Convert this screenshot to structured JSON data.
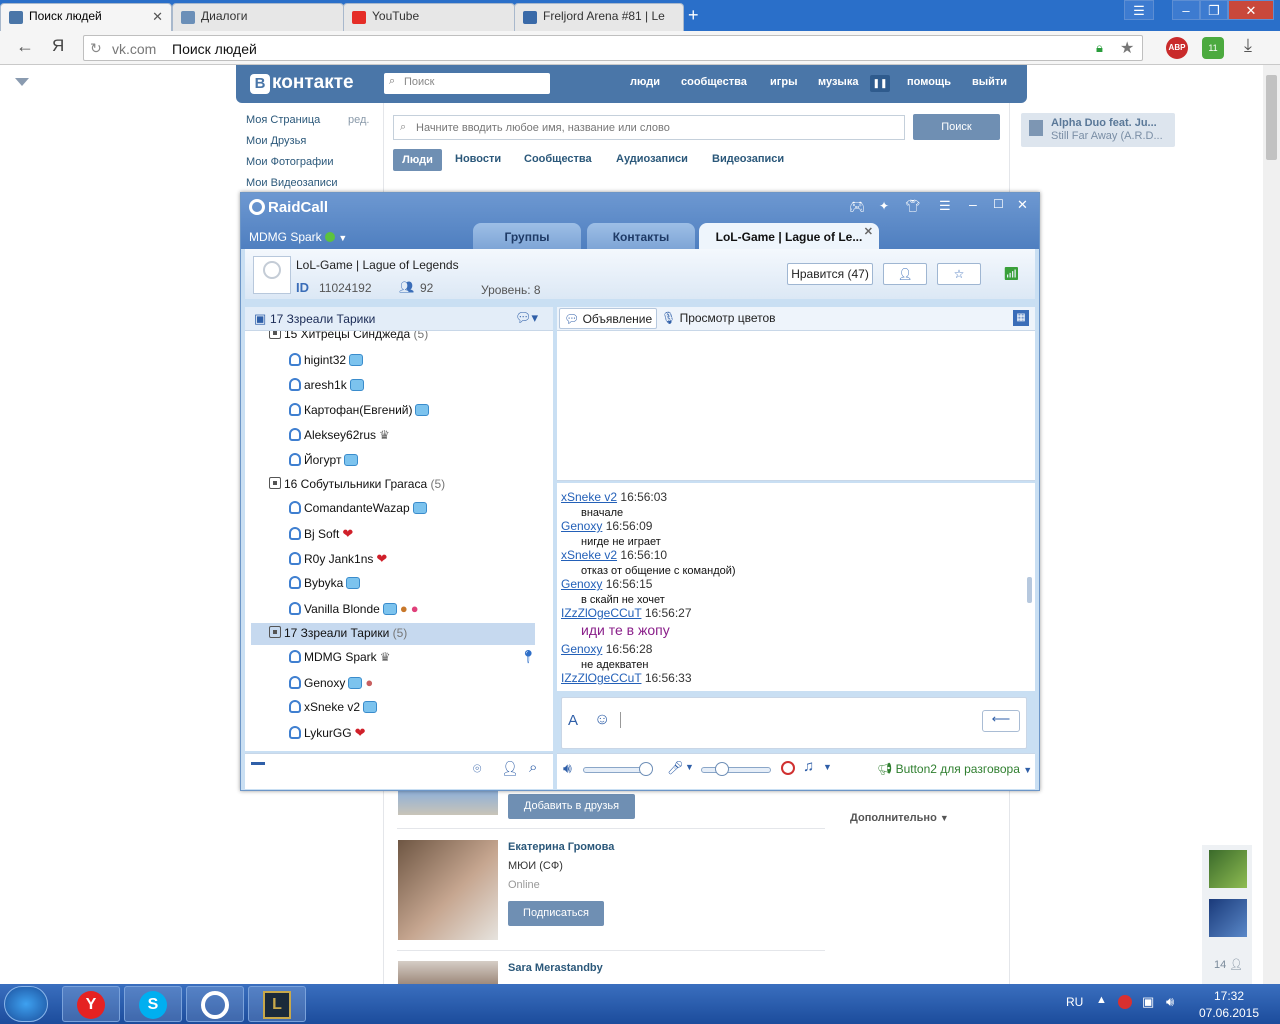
{
  "browser": {
    "tabs": [
      {
        "label": "Поиск людей",
        "active": true
      },
      {
        "label": "Диалоги",
        "active": false
      },
      {
        "label": "YouTube",
        "active": false
      },
      {
        "label": "Freljord Arena #81 | Le",
        "active": false
      }
    ],
    "url_domain": "vk.com",
    "url_title": "Поиск людей",
    "yandex_letter": "Я",
    "abp_label": "ABP",
    "ext_badge": "11"
  },
  "vk": {
    "logo": "контакте",
    "logo_letter": "В",
    "search_placeholder": "Поиск",
    "nav": [
      "люди",
      "сообщества",
      "игры",
      "музыка",
      "помощь",
      "выйти"
    ],
    "left_menu": [
      "Моя Страница",
      "Мои Друзья",
      "Мои Фотографии",
      "Мои Видеозаписи"
    ],
    "edit_label": "ред.",
    "people_search_placeholder": "Начните вводить любое имя, название или слово",
    "search_button": "Поиск",
    "tabs": [
      "Люди",
      "Новости",
      "Сообщества",
      "Аудиозаписи",
      "Видеозаписи"
    ],
    "player": {
      "artist": "Alpha Duo feat. Ju...",
      "track": "Still Far Away (A.R.D..."
    },
    "add_friend_button": "Добавить в друзья",
    "more_label": "Дополнительно",
    "people": [
      {
        "name": "Екатерина Громова",
        "sub": "МЮИ (СФ)",
        "status": "Online",
        "button": "Подписаться"
      },
      {
        "name": "Sara Merastandby",
        "sub": "",
        "status": "",
        "button": ""
      }
    ],
    "friends_count": "14"
  },
  "raidcall": {
    "logo": "RaidCall",
    "user": "MDMG Spark",
    "tabs": [
      "Группы",
      "Контакты",
      "LoL-Game | Lague of Le..."
    ],
    "group_name": "LoL-Game | Lague of Legends",
    "id_label": "ID",
    "group_id": "11024192",
    "members": "92",
    "level": "Уровень: 8",
    "like_button": "Нравится (47)",
    "channel_title": "17 Ззреали Тарики",
    "announce_label": "Объявление",
    "colors_label": "Просмотр цветов",
    "tree": [
      {
        "type": "group",
        "label": "15 Хитрецы Синджеда",
        "count": "(5)"
      },
      {
        "type": "user",
        "label": "higint32",
        "badges": [
          "gem"
        ]
      },
      {
        "type": "user",
        "label": "aresh1k",
        "badges": [
          "gem"
        ]
      },
      {
        "type": "user",
        "label": "Картофан(Евгений)",
        "badges": [
          "gem"
        ]
      },
      {
        "type": "user",
        "label": "Aleksey62rus",
        "badges": [
          "crown"
        ]
      },
      {
        "type": "user",
        "label": "Йогурт",
        "badges": [
          "gem"
        ]
      },
      {
        "type": "group",
        "label": "16 Собутыльники Граrаса",
        "count": "(5)"
      },
      {
        "type": "user",
        "label": "ComandanteWazap",
        "badges": [
          "gem"
        ]
      },
      {
        "type": "user",
        "label": "Bj Soft",
        "badges": [
          "heart"
        ]
      },
      {
        "type": "user",
        "label": "R0y Jank1ns",
        "badges": [
          "heart"
        ]
      },
      {
        "type": "user",
        "label": "Bybyka",
        "badges": [
          "gem"
        ]
      },
      {
        "type": "user",
        "label": "Vanilla Blonde",
        "badges": [
          "gem",
          "heart",
          "heart"
        ]
      },
      {
        "type": "group",
        "label": "17 Ззреали Тарики",
        "count": "(5)"
      },
      {
        "type": "user",
        "label": "MDMG Spark",
        "badges": [
          "crown"
        ]
      },
      {
        "type": "user",
        "label": "Genoxy",
        "badges": [
          "gem",
          "heart"
        ]
      },
      {
        "type": "user",
        "label": "xSneke v2",
        "badges": [
          "gem"
        ]
      },
      {
        "type": "user",
        "label": "LykurGG",
        "badges": [
          "heart"
        ]
      }
    ],
    "messages": [
      {
        "name": "xSneke v2",
        "time": "16:56:03",
        "text": "вначале"
      },
      {
        "name": "Genoxy",
        "time": "16:56:09",
        "text": "нигде не играет"
      },
      {
        "name": "xSneke v2",
        "time": "16:56:10",
        "text": "отказ от общение с командой)"
      },
      {
        "name": "Genoxy",
        "time": "16:56:15",
        "text": "в скайп не хочет"
      },
      {
        "name": "IZzZlOgeCCuT",
        "time": "16:56:27",
        "text": "иди те в жопу"
      },
      {
        "name": "Genoxy",
        "time": "16:56:28",
        "text": "не адекватен"
      },
      {
        "name": "IZzZlOgeCCuT",
        "time": "16:56:33",
        "text": ""
      }
    ],
    "voice_mode": "Button2 для разговора"
  },
  "taskbar": {
    "lang": "RU",
    "time": "17:32",
    "date": "07.06.2015"
  },
  "colors": {
    "vk_blue": "#4a76a8",
    "rc_blue": "#5a8ac8",
    "taskbar": "#1c4c9c"
  }
}
